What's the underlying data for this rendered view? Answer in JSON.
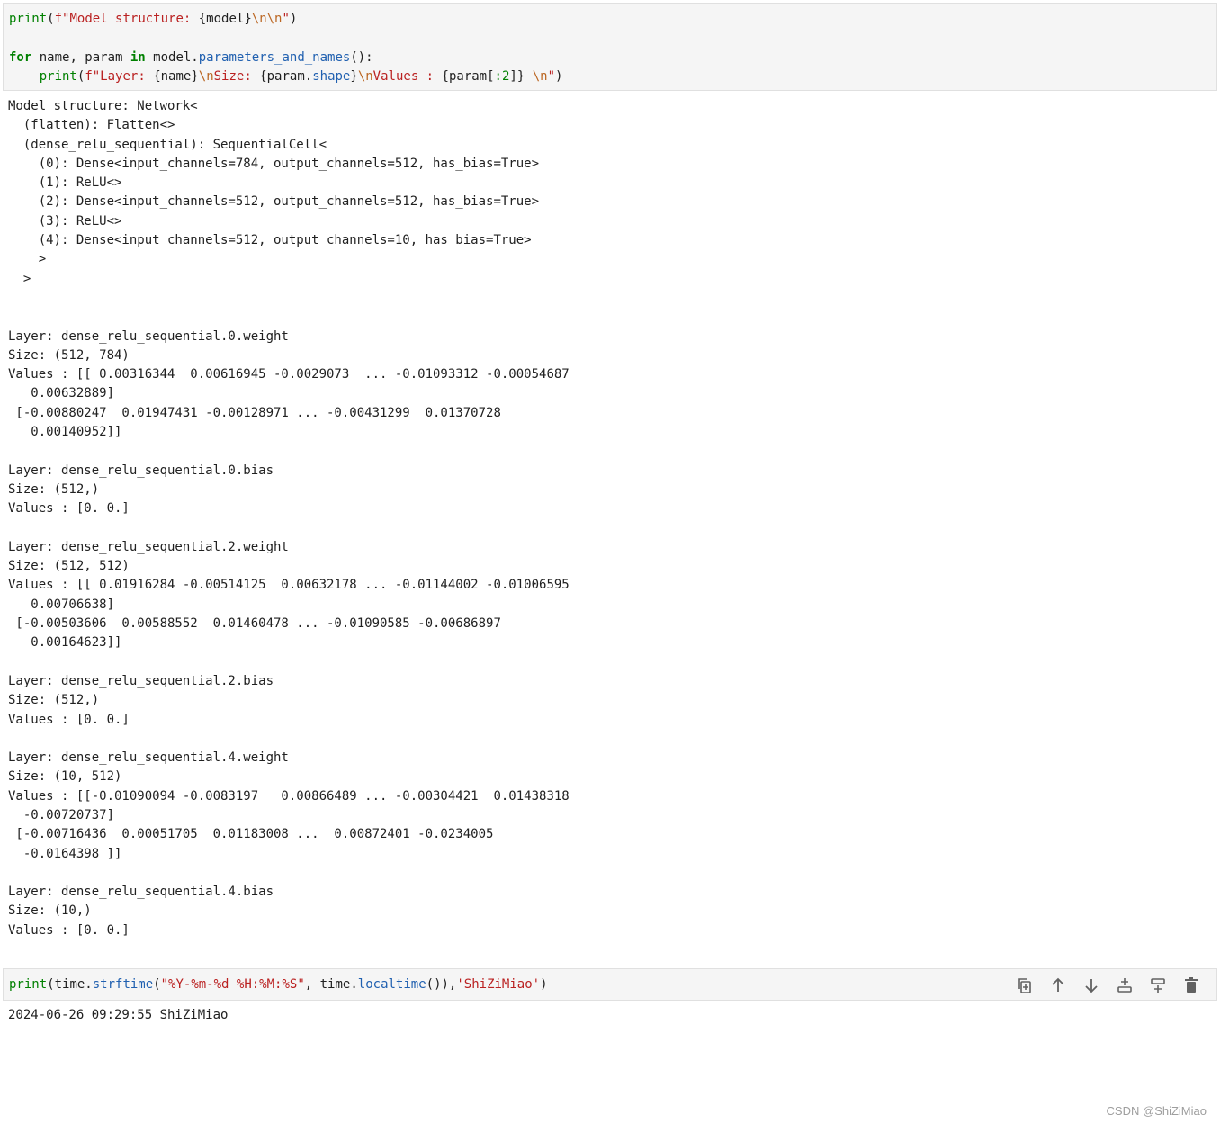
{
  "cell1": {
    "line1_print": "print",
    "line1_open": "(",
    "line1_fprefix": "f",
    "line1_str_a": "\"Model structure: ",
    "line1_interp": "{model}",
    "line1_esc": "\\n\\n",
    "line1_str_end": "\"",
    "line1_close": ")",
    "line3_for": "for",
    "line3_mid": " name, param ",
    "line3_in": "in",
    "line3_obj": " model.",
    "line3_attr": "parameters_and_names",
    "line3_end": "():",
    "line4_indent": "    ",
    "line4_print": "print",
    "line4_open": "(",
    "line4_fprefix": "f",
    "line4_str_a": "\"Layer: ",
    "line4_interp1": "{name}",
    "line4_esc1": "\\n",
    "line4_str_b": "Size: ",
    "line4_interp2a": "{param.",
    "line4_interp2attr": "shape",
    "line4_interp2b": "}",
    "line4_esc2": "\\n",
    "line4_str_c": "Values : ",
    "line4_interp3": "{param[",
    "line4_slice": ":2",
    "line4_interp3b": "]}",
    "line4_space": " ",
    "line4_esc3": "\\n",
    "line4_str_end": "\"",
    "line4_close": ")"
  },
  "output1": "Model structure: Network<\n  (flatten): Flatten<>\n  (dense_relu_sequential): SequentialCell<\n    (0): Dense<input_channels=784, output_channels=512, has_bias=True>\n    (1): ReLU<>\n    (2): Dense<input_channels=512, output_channels=512, has_bias=True>\n    (3): ReLU<>\n    (4): Dense<input_channels=512, output_channels=10, has_bias=True>\n    >\n  >\n\n\nLayer: dense_relu_sequential.0.weight\nSize: (512, 784)\nValues : [[ 0.00316344  0.00616945 -0.0029073  ... -0.01093312 -0.00054687\n   0.00632889]\n [-0.00880247  0.01947431 -0.00128971 ... -0.00431299  0.01370728\n   0.00140952]]\n\nLayer: dense_relu_sequential.0.bias\nSize: (512,)\nValues : [0. 0.]\n\nLayer: dense_relu_sequential.2.weight\nSize: (512, 512)\nValues : [[ 0.01916284 -0.00514125  0.00632178 ... -0.01144002 -0.01006595\n   0.00706638]\n [-0.00503606  0.00588552  0.01460478 ... -0.01090585 -0.00686897\n   0.00164623]]\n\nLayer: dense_relu_sequential.2.bias\nSize: (512,)\nValues : [0. 0.]\n\nLayer: dense_relu_sequential.4.weight\nSize: (10, 512)\nValues : [[-0.01090094 -0.0083197   0.00866489 ... -0.00304421  0.01438318\n  -0.00720737]\n [-0.00716436  0.00051705  0.01183008 ...  0.00872401 -0.0234005\n  -0.0164398 ]]\n\nLayer: dense_relu_sequential.4.bias\nSize: (10,)\nValues : [0. 0.]",
  "cell2": {
    "print": "print",
    "open": "(time.",
    "attr1": "strftime",
    "paren": "(",
    "fmt": "\"%Y-%m-%d %H:%M:%S\"",
    "mid": ", time.",
    "attr2": "localtime",
    "mid2": "()),",
    "name": "'ShiZiMiao'",
    "close": ")"
  },
  "output2": "2024-06-26 09:29:55 ShiZiMiao",
  "toolbar_icons": [
    "duplicate-icon",
    "move-up-icon",
    "move-down-icon",
    "insert-above-icon",
    "insert-below-icon",
    "delete-icon"
  ],
  "watermark": "CSDN @ShiZiMiao"
}
